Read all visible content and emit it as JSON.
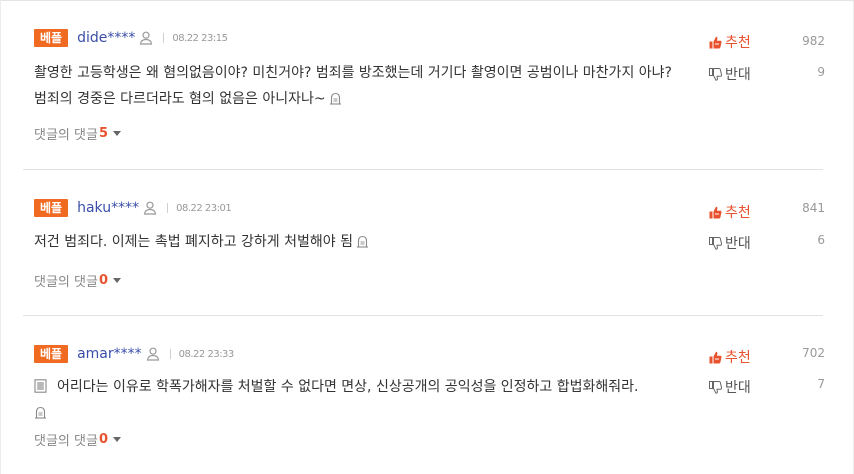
{
  "colors": {
    "best_badge": "#f06a22",
    "author": "#3a4ea8",
    "upvote": "#e8532f",
    "reply_count": "#e8532f",
    "divider": "#e2e2e2"
  },
  "icons": {
    "user": "user-outline-icon",
    "emoticon": "emoticon-box-icon",
    "upvote": "thumbs-up-icon",
    "downvote": "thumbs-down-icon",
    "caret": "caret-down-icon"
  },
  "comments": [
    {
      "badge": "베플",
      "author": "dide****",
      "timestamp": "08.22 23:15",
      "text_before": "촬영한 고등학생은 왜 혐의없음이야? 미친거야? 범죄를 방조했는데 거기다 촬영이면 공범이나 마찬가지 아냐? 범죄의 경중은 다르더라도 혐의 없음은 아니자나~",
      "text_after": "",
      "reply_label": "댓글의 댓글",
      "reply_count": "5",
      "up_label": "추천",
      "up_count": "982",
      "down_label": "반대",
      "down_count": "9"
    },
    {
      "badge": "베플",
      "author": "haku****",
      "timestamp": "08.22 23:01",
      "text_before": "저건 범죄다. 이제는 촉법 폐지하고 강하게 처벌해야 됨",
      "text_after": "",
      "reply_label": "댓글의 댓글",
      "reply_count": "0",
      "up_label": "추천",
      "up_count": "841",
      "down_label": "반대",
      "down_count": "6"
    },
    {
      "badge": "베플",
      "author": "amar****",
      "timestamp": "08.22 23:33",
      "text_before": "어리다는 이유로 학폭가해자를 처벌할 수 없다면 면상, 신상공개의 공익성을 인정하고 합법화해줘라.",
      "text_after": "",
      "reply_label": "댓글의 댓글",
      "reply_count": "0",
      "up_label": "추천",
      "up_count": "702",
      "down_label": "반대",
      "down_count": "7"
    }
  ]
}
